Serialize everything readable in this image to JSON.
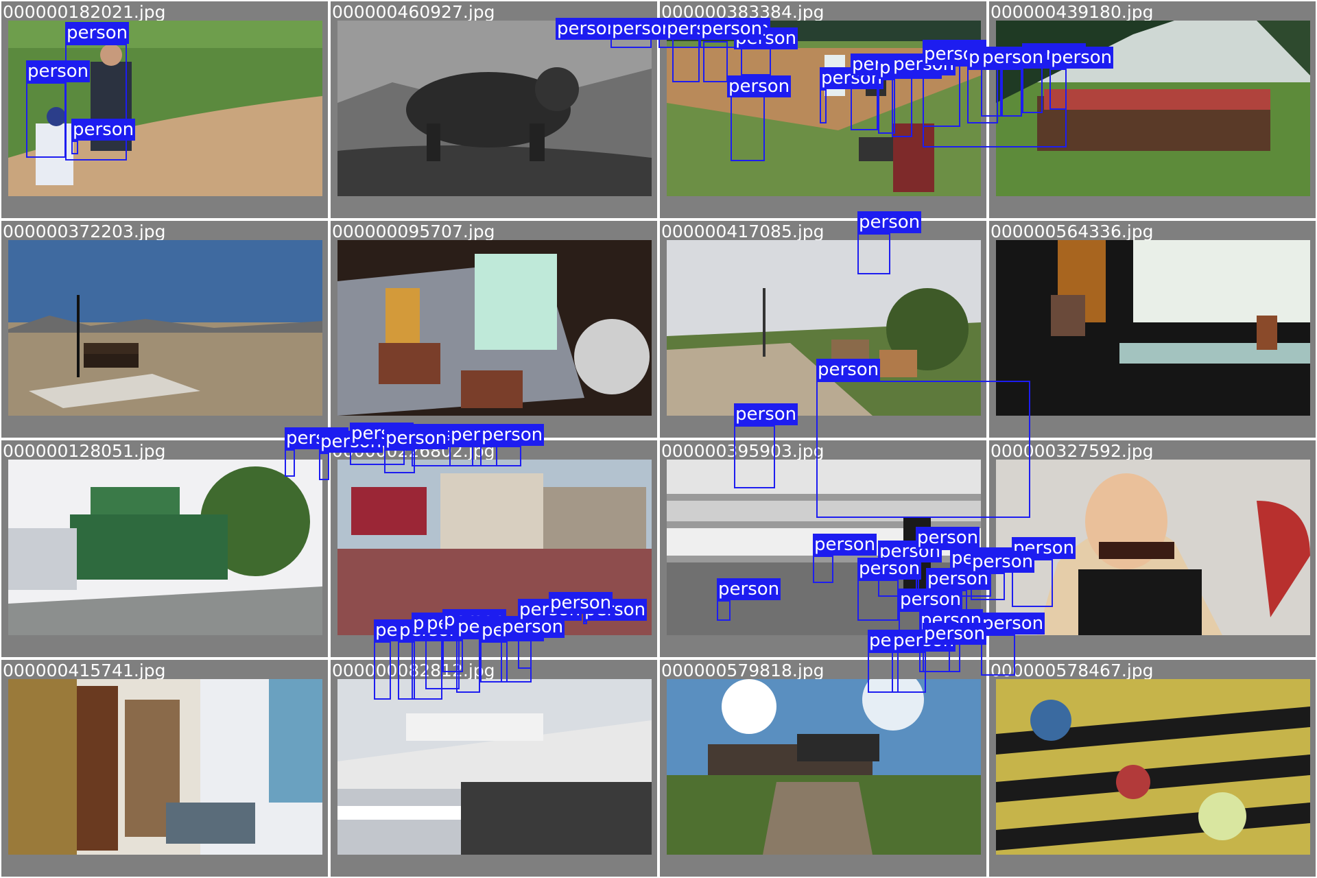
{
  "colors": {
    "background": "#7f7f7f",
    "grid_line": "#ffffff",
    "box": "#1d1df0",
    "label_text": "#ffffff"
  },
  "tiles": [
    {
      "filename": "000000182021.jpg",
      "label": "person",
      "box_count": 3
    },
    {
      "filename": "000000460927.jpg",
      "label": "",
      "box_count": 0
    },
    {
      "filename": "000000383384.jpg",
      "label": "person",
      "box_count": 7
    },
    {
      "filename": "000000439180.jpg",
      "label": "person",
      "box_count": 11
    },
    {
      "filename": "000000372203.jpg",
      "label": "",
      "box_count": 0
    },
    {
      "filename": "000000095707.jpg",
      "label": "",
      "box_count": 0
    },
    {
      "filename": "000000417085.jpg",
      "label": "",
      "box_count": 0
    },
    {
      "filename": "000000564336.jpg",
      "label": "person",
      "box_count": 1
    },
    {
      "filename": "000000128051.jpg",
      "label": "",
      "box_count": 0
    },
    {
      "filename": "000000226802.jpg",
      "label": "person",
      "box_count": 7
    },
    {
      "filename": "000000395903.jpg",
      "label": "person",
      "box_count": 1
    },
    {
      "filename": "000000327592.jpg",
      "label": "person",
      "box_count": 1
    },
    {
      "filename": "000000415741.jpg",
      "label": "",
      "box_count": 0
    },
    {
      "filename": "000000082812.jpg",
      "label": "person",
      "box_count": 9
    },
    {
      "filename": "000000579818.jpg",
      "label": "person",
      "box_count": 3
    },
    {
      "filename": "000000578467.jpg",
      "label": "person",
      "box_count": 14
    }
  ]
}
